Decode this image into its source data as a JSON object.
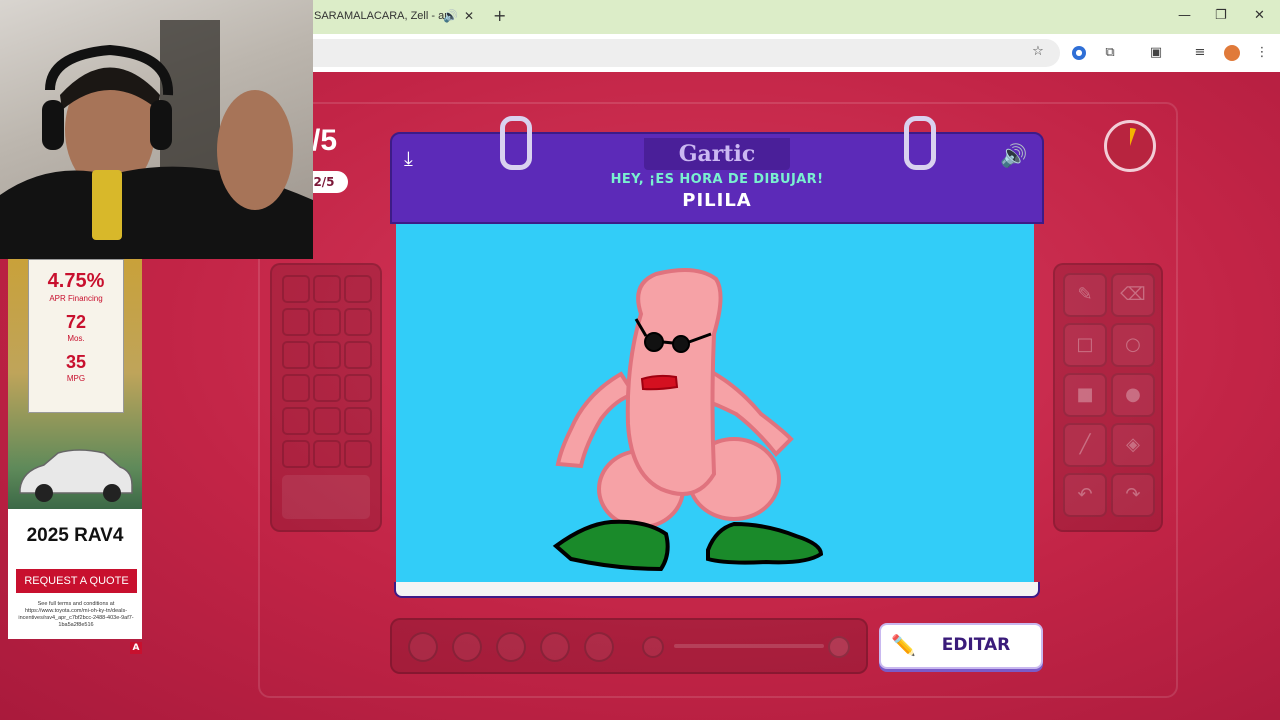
{
  "browser": {
    "tab_title": "SARAMALACARA, Zell - au",
    "tab_audio_icon": "speaker-icon",
    "tab_close_icon": "close-icon",
    "new_tab_icon": "plus-icon"
  },
  "game": {
    "round_big": "/5",
    "round_pill": "2/5",
    "logo": "Gartic",
    "subtitle": "HEY, ¡ES HORA DE DIBUJAR!",
    "word": "PILILA",
    "edit_label": "EDITAR",
    "canvas_color": "#32cdf8",
    "timer_fraction": 0.12
  },
  "ad": {
    "rate": "4.75%",
    "rate_sub": "APR Financing",
    "months": "72",
    "months_sub": "Mos.",
    "mpg": "35",
    "mpg_sub": "MPG",
    "model": "2025 RAV4",
    "cta": "REQUEST A QUOTE",
    "fine_print": "See full terms and conditions at https://www.toyota.com/mi-oh-ky-tn/deals-incentives/rav4_apr_c7bf2bcc-2488-403e-9af7-1ba5a2f8e516",
    "adchoices": "A"
  }
}
